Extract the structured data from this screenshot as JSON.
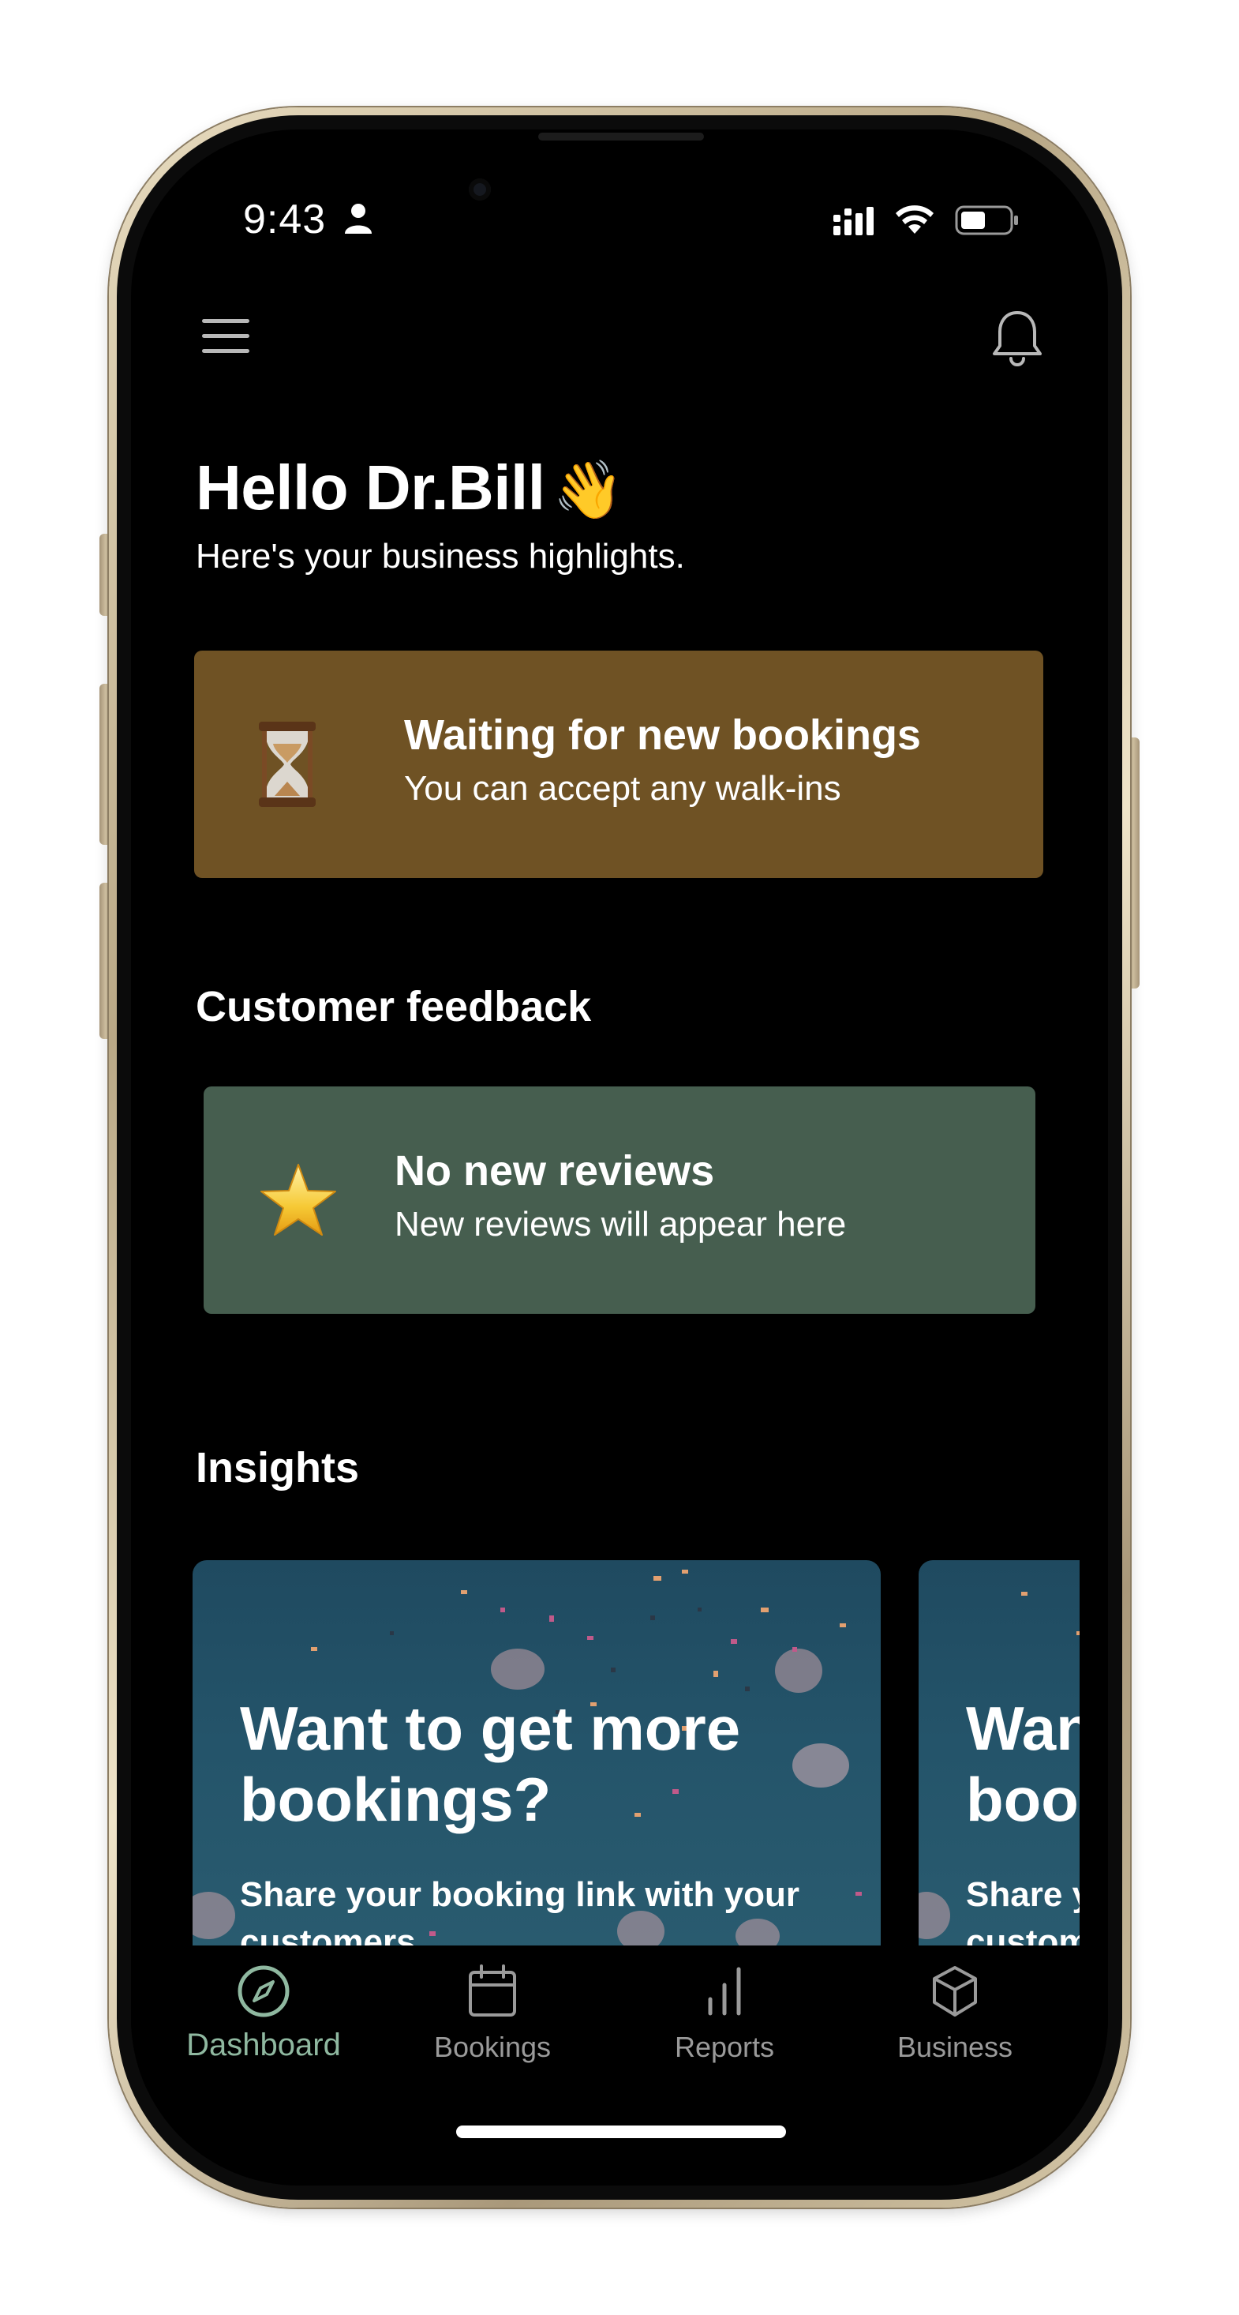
{
  "status_bar": {
    "time": "9:43",
    "person_icon": "person-icon",
    "signal_icon": "cellular-signal-icon",
    "wifi_icon": "wifi-icon",
    "battery_icon": "battery-icon"
  },
  "header": {
    "menu_icon": "hamburger-menu-icon",
    "notifications_icon": "bell-icon"
  },
  "greeting": {
    "title": "Hello Dr.Bill",
    "emoji": "👋",
    "subtitle": "Here's your business highlights."
  },
  "bookings_card": {
    "icon": "hourglass-icon",
    "title": "Waiting for new bookings",
    "subtitle": "You can accept any walk-ins",
    "background": "#6f5224"
  },
  "feedback": {
    "heading": "Customer feedback",
    "card": {
      "icon": "star-icon",
      "title": "No new reviews",
      "subtitle": "New reviews will appear here",
      "background": "#465e4f"
    }
  },
  "insights": {
    "heading": "Insights",
    "cards": [
      {
        "title": "Want to get more bookings?",
        "subtitle": "Share your booking link with your customers"
      },
      {
        "title": "Want to get more bookings?",
        "subtitle": "Share your booking link with your customers"
      }
    ]
  },
  "tabbar": {
    "active_color": "#8fb8a0",
    "items": [
      {
        "label": "Dashboard",
        "icon": "compass-icon",
        "active": true
      },
      {
        "label": "Bookings",
        "icon": "calendar-icon",
        "active": false
      },
      {
        "label": "Reports",
        "icon": "bar-chart-icon",
        "active": false
      },
      {
        "label": "Business",
        "icon": "cube-icon",
        "active": false
      }
    ]
  }
}
